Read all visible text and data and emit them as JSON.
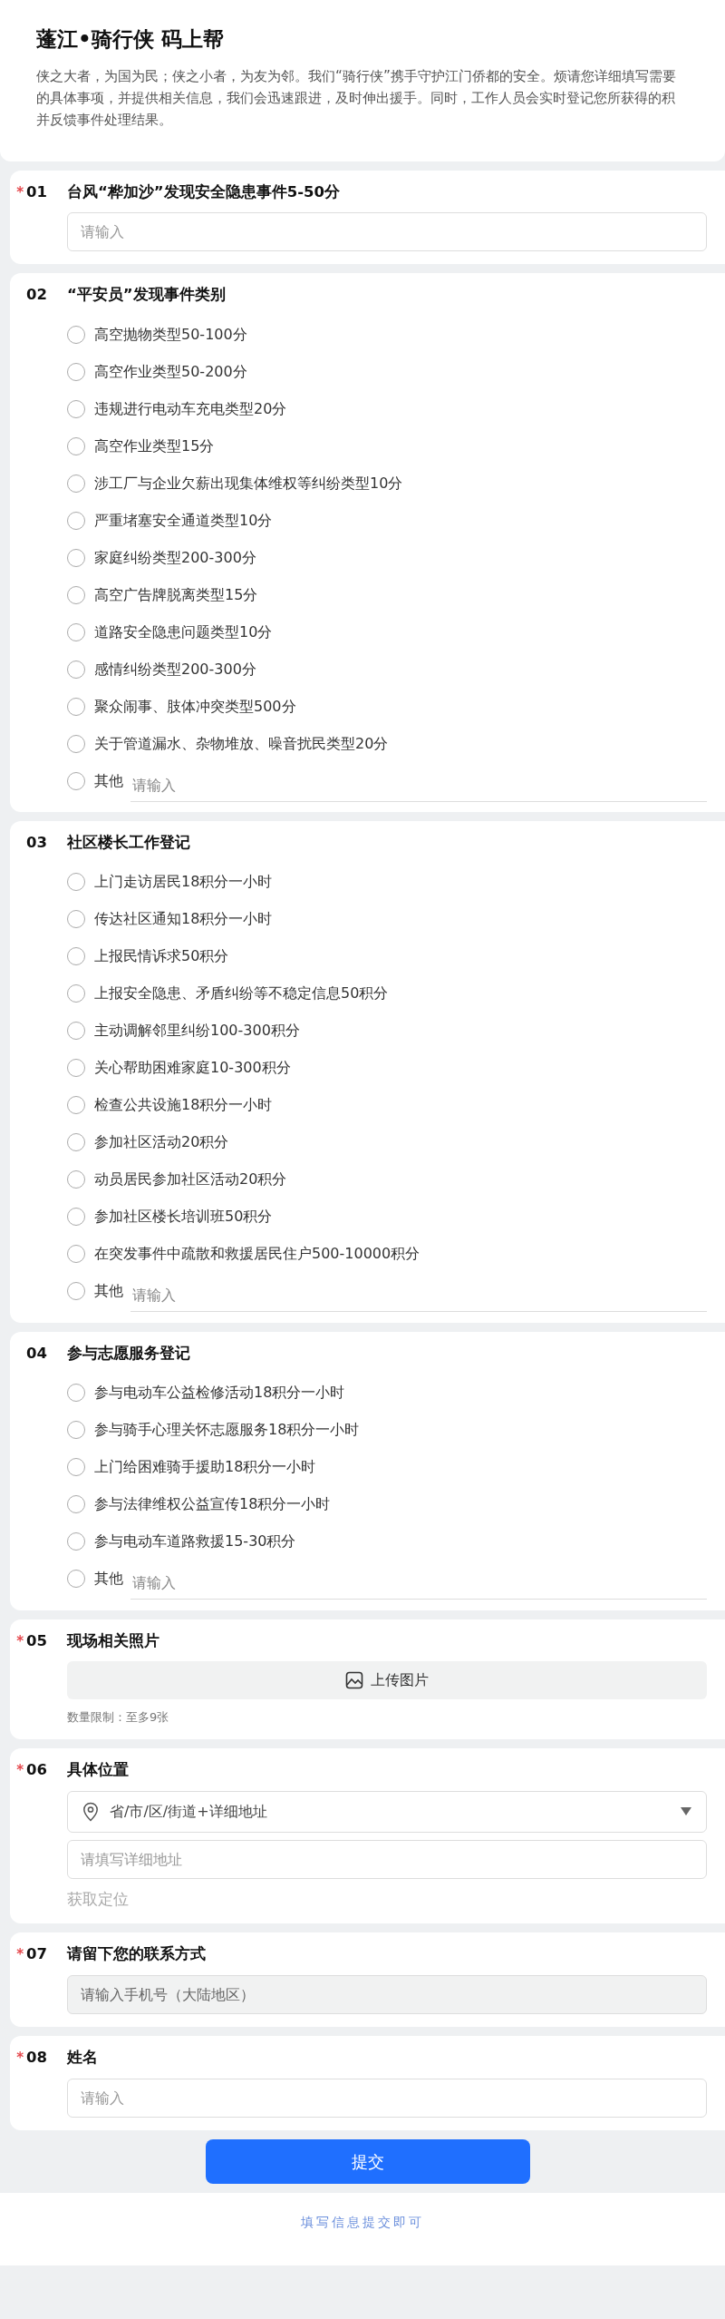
{
  "header": {
    "title": "蓬江•骑行侠 码上帮",
    "intro_lines": [
      "侠之大者，为国为民；侠之小者，为友为邻。我们“骑行侠”携手守护江门侨都的安全。烦请您详细填写需要",
      "的具体事项，并提供相关信息，我们会迅速跟进，及时伸出援手。同时，工作人员会实时登记您所获得的积",
      "并反馈事件处理结果。"
    ]
  },
  "required_symbol": "*",
  "questions": [
    {
      "number": "01",
      "title": "台风“桦加沙”发现安全隐患事件5-50分",
      "required": true,
      "kind": "text",
      "placeholder": "请输入",
      "disabled": false
    },
    {
      "number": "02",
      "title": "“平安员”发现事件类别",
      "required": false,
      "kind": "radio",
      "options": [
        {
          "label": "高空抛物类型50-100分",
          "selected": false
        },
        {
          "label": "高空作业类型50-200分",
          "selected": false
        },
        {
          "label": "违规进行电动车充电类型20分",
          "selected": false
        },
        {
          "label": "高空作业类型15分",
          "selected": false
        },
        {
          "label": "涉工厂与企业欠薪出现集体维权等纠纷类型10分",
          "selected": false
        },
        {
          "label": "严重堵塞安全通道类型10分",
          "selected": false
        },
        {
          "label": "家庭纠纷类型200-300分",
          "selected": false
        },
        {
          "label": "高空广告牌脱离类型15分",
          "selected": false
        },
        {
          "label": "道路安全隐患问题类型10分",
          "selected": false
        },
        {
          "label": "感情纠纷类型200-300分",
          "selected": false
        },
        {
          "label": "聚众闹事、肢体冲突类型500分",
          "selected": false
        },
        {
          "label": "关于管道漏水、杂物堆放、噪音扰民类型20分",
          "selected": false
        }
      ],
      "other": {
        "label": "其他",
        "placeholder": "请输入",
        "selected": false
      }
    },
    {
      "number": "03",
      "title": "社区楼长工作登记",
      "required": false,
      "kind": "radio",
      "options": [
        {
          "label": "上门走访居民18积分一小时",
          "selected": false
        },
        {
          "label": "传达社区通知18积分一小时",
          "selected": false
        },
        {
          "label": "上报民情诉求50积分",
          "selected": false
        },
        {
          "label": "上报安全隐患、矛盾纠纷等不稳定信息50积分",
          "selected": false
        },
        {
          "label": "主动调解邻里纠纷100-300积分",
          "selected": false
        },
        {
          "label": "关心帮助困难家庭10-300积分",
          "selected": false
        },
        {
          "label": "检查公共设施18积分一小时",
          "selected": false
        },
        {
          "label": "参加社区活动20积分",
          "selected": false
        },
        {
          "label": "动员居民参加社区活动20积分",
          "selected": false
        },
        {
          "label": "参加社区楼长培训班50积分",
          "selected": false
        },
        {
          "label": "在突发事件中疏散和救援居民住户500-10000积分",
          "selected": false
        }
      ],
      "other": {
        "label": "其他",
        "placeholder": "请输入",
        "selected": false
      }
    },
    {
      "number": "04",
      "title": "参与志愿服务登记",
      "required": false,
      "kind": "radio",
      "options": [
        {
          "label": "参与电动车公益检修活动18积分一小时",
          "selected": false
        },
        {
          "label": "参与骑手心理关怀志愿服务18积分一小时",
          "selected": false
        },
        {
          "label": "上门给困难骑手援助18积分一小时",
          "selected": false
        },
        {
          "label": "参与法律维权公益宣传18积分一小时",
          "selected": false
        },
        {
          "label": "参与电动车道路救援15-30积分",
          "selected": false
        }
      ],
      "other": {
        "label": "其他",
        "placeholder": "请输入",
        "selected": false
      }
    },
    {
      "number": "05",
      "title": "现场相关照片",
      "required": true,
      "kind": "upload",
      "button": "上传图片",
      "note": "数量限制：至多9张"
    },
    {
      "number": "06",
      "title": "具体位置",
      "required": true,
      "kind": "location",
      "select": "省/市/区/街道+详细地址",
      "placeholder": "请填写详细地址",
      "link": "获取定位"
    },
    {
      "number": "07",
      "title": "请留下您的联系方式",
      "required": true,
      "kind": "text",
      "placeholder": "请输入手机号（大陆地区）",
      "disabled": true
    },
    {
      "number": "08",
      "title": "姓名",
      "required": true,
      "kind": "text",
      "placeholder": "请输入",
      "disabled": false
    }
  ],
  "submit": "提交",
  "footer": "填写信息提交即可"
}
